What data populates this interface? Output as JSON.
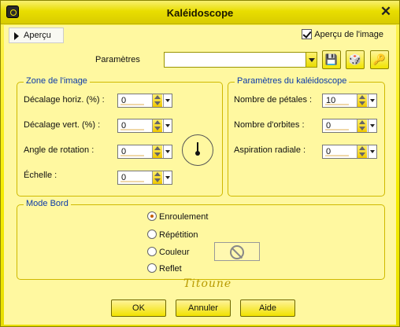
{
  "window": {
    "title": "Kaléidoscope"
  },
  "apercu": {
    "label": "Aperçu",
    "checkbox_label": "Aperçu de l'image",
    "checked": true
  },
  "parametres": {
    "label": "Paramètres",
    "value": ""
  },
  "zone_image": {
    "title": "Zone de l'image",
    "fields": [
      {
        "label": "Décalage horiz. (%) :",
        "value": "0"
      },
      {
        "label": "Décalage vert. (%) :",
        "value": "0"
      },
      {
        "label": "Angle de rotation :",
        "value": "0"
      },
      {
        "label": "Échelle :",
        "value": "0"
      }
    ]
  },
  "kaleido": {
    "title": "Paramètres du kaléidoscope",
    "fields": [
      {
        "label": "Nombre de pétales :",
        "value": "10"
      },
      {
        "label": "Nombre d'orbites :",
        "value": "0"
      },
      {
        "label": "Aspiration radiale :",
        "value": "0"
      }
    ]
  },
  "mode_bord": {
    "title": "Mode Bord",
    "options": [
      {
        "label": "Enroulement",
        "selected": true
      },
      {
        "label": "Répétition",
        "selected": false
      },
      {
        "label": "Couleur",
        "selected": false
      },
      {
        "label": "Reflet",
        "selected": false
      }
    ]
  },
  "signature": "Titoune",
  "buttons": {
    "ok": "OK",
    "cancel": "Annuler",
    "help": "Aide"
  },
  "icons": {
    "save": "save-icon",
    "random": "dice-icon",
    "reset": "reset-icon",
    "close": "close-icon"
  },
  "colors": {
    "accent_yellow": "#f4ec00",
    "group_title_blue": "#0b3aa8"
  }
}
